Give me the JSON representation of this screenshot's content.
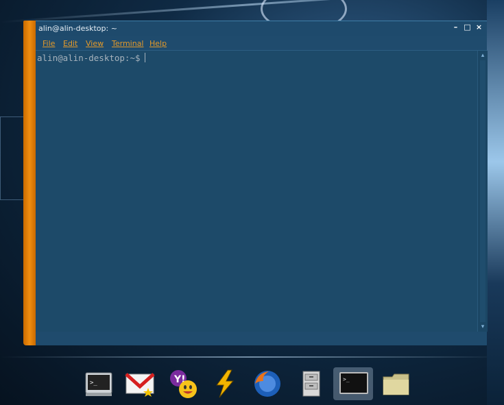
{
  "window": {
    "title": "alin@alin-desktop: ~",
    "controls": {
      "minimize": "–",
      "maximize": "□",
      "close": "×"
    }
  },
  "menu": [
    "File",
    "Edit",
    "View",
    "Terminal",
    "Help"
  ],
  "terminal": {
    "prompt": "alin@alin-desktop:~$"
  },
  "scrollbar": {
    "up": "▴",
    "down": "▾"
  },
  "colors": {
    "terminal_bg": "#1d4a69",
    "menu_text": "#e49a2a",
    "accent_orange": "#f08e10"
  },
  "dock": {
    "icons": [
      "terminal-icon",
      "gmail-icon",
      "yahoo-messenger-icon",
      "winamp-icon",
      "firefox-icon",
      "file-cabinet-icon",
      "terminal-active-icon",
      "folder-icon"
    ]
  }
}
